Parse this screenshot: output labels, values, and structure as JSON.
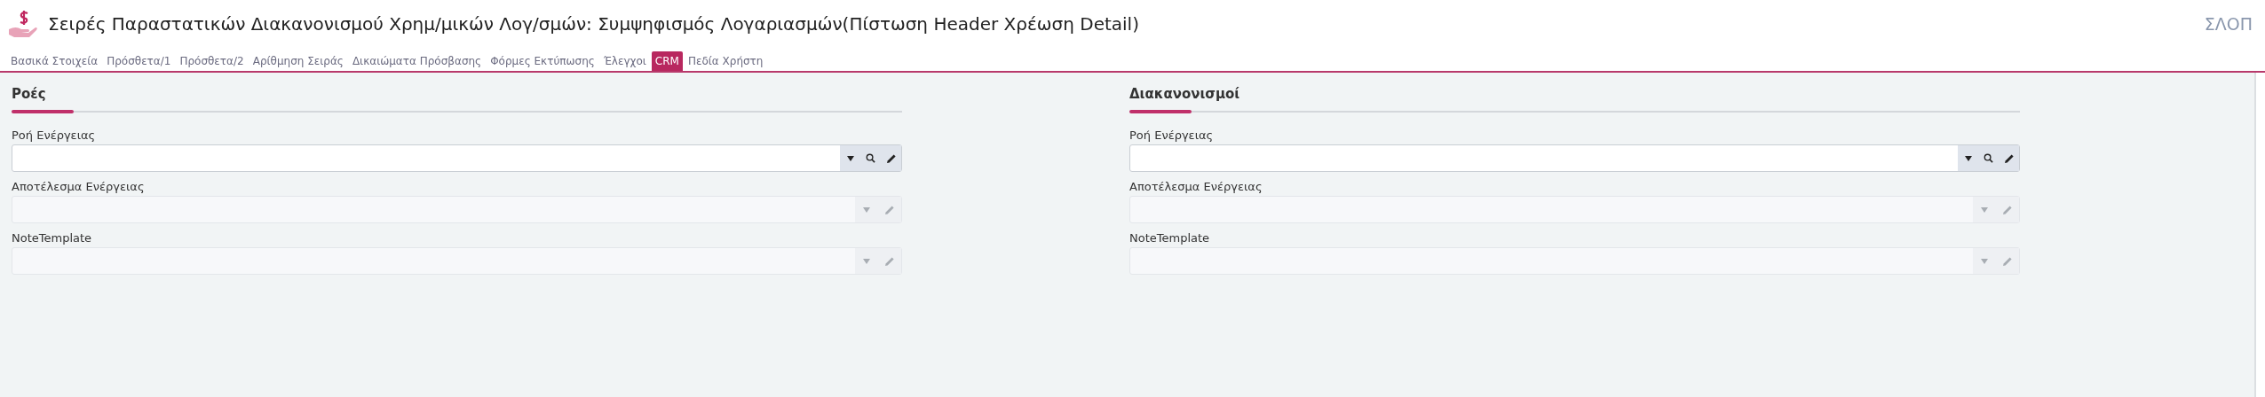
{
  "header": {
    "title": "Σειρές Παραστατικών Διακανονισμού Χρημ/μικών Λογ/σμών: Συμψηφισμός Λογαριασμών(Πίστωση Header Χρέωση Detail)",
    "user": "ΣΛΟΠ"
  },
  "tabs": [
    {
      "label": "Βασικά Στοιχεία",
      "selected": false
    },
    {
      "label": "Πρόσθετα/1",
      "selected": false
    },
    {
      "label": "Πρόσθετα/2",
      "selected": false
    },
    {
      "label": "Αρίθμηση Σειράς",
      "selected": false
    },
    {
      "label": "Δικαιώματα Πρόσβασης",
      "selected": false
    },
    {
      "label": "Φόρμες Εκτύπωσης",
      "selected": false
    },
    {
      "label": "Έλεγχοι",
      "selected": false
    },
    {
      "label": "CRM",
      "selected": true
    },
    {
      "label": "Πεδία Χρήστη",
      "selected": false
    }
  ],
  "sections": [
    {
      "title": "Ροές",
      "fields": [
        {
          "label": "Ροή Ενέργειας",
          "kind": "lookup",
          "disabled": false
        },
        {
          "label": "Αποτέλεσμα Ενέργειας",
          "kind": "select",
          "disabled": true
        },
        {
          "label": "NoteTemplate",
          "kind": "select",
          "disabled": true
        }
      ]
    },
    {
      "title": "Διακανονισμοί",
      "fields": [
        {
          "label": "Ροή Ενέργειας",
          "kind": "lookup",
          "disabled": false
        },
        {
          "label": "Αποτέλεσμα Ενέργειας",
          "kind": "select",
          "disabled": true
        },
        {
          "label": "NoteTemplate",
          "kind": "select",
          "disabled": true
        }
      ]
    }
  ]
}
